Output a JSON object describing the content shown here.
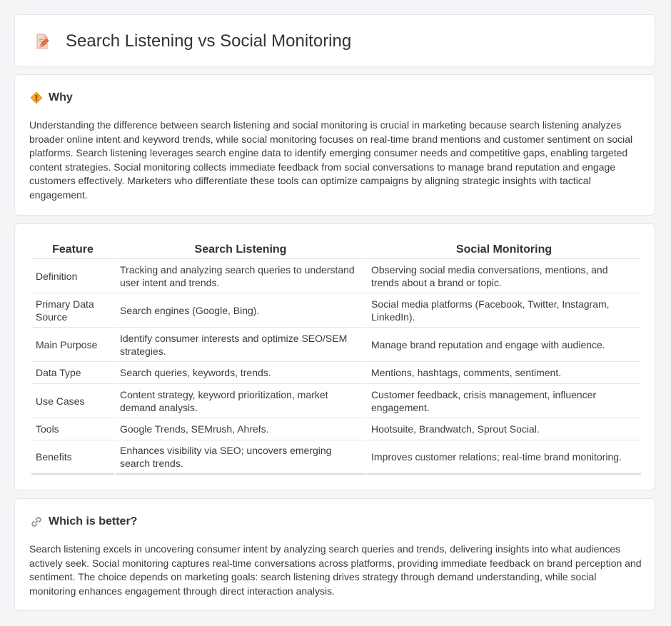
{
  "header": {
    "title": "Search Listening vs Social Monitoring",
    "icon": "document-pencil-icon"
  },
  "why": {
    "title": "Why",
    "icon": "diamond-sign-icon",
    "text": "Understanding the difference between search listening and social monitoring is crucial in marketing because search listening analyzes broader online intent and keyword trends, while social monitoring focuses on real-time brand mentions and customer sentiment on social platforms. Search listening leverages search engine data to identify emerging consumer needs and competitive gaps, enabling targeted content strategies. Social monitoring collects immediate feedback from social conversations to manage brand reputation and engage customers effectively. Marketers who differentiate these tools can optimize campaigns by aligning strategic insights with tactical engagement."
  },
  "table": {
    "headers": [
      "Feature",
      "Search Listening",
      "Social Monitoring"
    ],
    "rows": [
      [
        "Definition",
        "Tracking and analyzing search queries to understand user intent and trends.",
        "Observing social media conversations, mentions, and trends about a brand or topic."
      ],
      [
        "Primary Data Source",
        "Search engines (Google, Bing).",
        "Social media platforms (Facebook, Twitter, Instagram, LinkedIn)."
      ],
      [
        "Main Purpose",
        "Identify consumer interests and optimize SEO/SEM strategies.",
        "Manage brand reputation and engage with audience."
      ],
      [
        "Data Type",
        "Search queries, keywords, trends.",
        "Mentions, hashtags, comments, sentiment."
      ],
      [
        "Use Cases",
        "Content strategy, keyword prioritization, market demand analysis.",
        "Customer feedback, crisis management, influencer engagement."
      ],
      [
        "Tools",
        "Google Trends, SEMrush, Ahrefs.",
        "Hootsuite, Brandwatch, Sprout Social."
      ],
      [
        "Benefits",
        "Enhances visibility via SEO; uncovers emerging search trends.",
        "Improves customer relations; real-time brand monitoring."
      ]
    ]
  },
  "better": {
    "title": "Which is better?",
    "icon": "link-icon",
    "text": "Search listening excels in uncovering consumer intent by analyzing search queries and trends, delivering insights into what audiences actively seek. Social monitoring captures real-time conversations across platforms, providing immediate feedback on brand perception and sentiment. The choice depends on marketing goals: search listening drives strategy through demand understanding, while social monitoring enhances engagement through direct interaction analysis."
  }
}
